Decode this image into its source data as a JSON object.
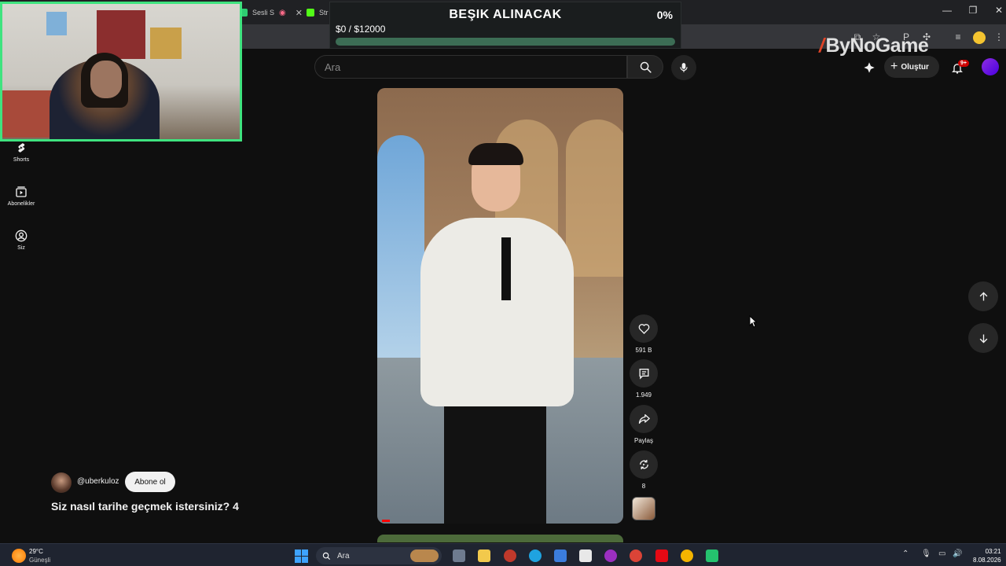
{
  "browser": {
    "tabs": [
      {
        "label": "Sesli S"
      },
      {
        "label": "Str"
      }
    ],
    "window_controls": [
      "—",
      "❐",
      "✕"
    ]
  },
  "goal": {
    "title": "BEŞIK ALINACAK",
    "percent_label": "0%",
    "amount": "$0 / $12000",
    "progress_fraction": 0.0
  },
  "watermark": {
    "logo_text": "ByNoGame"
  },
  "header": {
    "search_placeholder": "Ara",
    "create_label": "Oluştur",
    "notifications_badge": "9+"
  },
  "sidebar": {
    "items": [
      {
        "label": "Shorts",
        "icon": "shorts-icon"
      },
      {
        "label": "Abonelikler",
        "icon": "subscriptions-icon"
      },
      {
        "label": "Siz",
        "icon": "you-icon"
      }
    ]
  },
  "short": {
    "channel": "@uberkuloz",
    "subscribe_label": "Abone ol",
    "title": "Siz nasıl tarihe geçmek istersiniz? 4",
    "actions": {
      "like_count": "591 B",
      "comment_count": "1.949",
      "share_label": "Paylaş",
      "remix_count": "8"
    }
  },
  "taskbar": {
    "temperature": "29°C",
    "weather": "Güneşli",
    "search_label": "Ara",
    "time": "03:21",
    "date": "8.08.2026"
  },
  "colors": {
    "background": "#0f0f0f",
    "goal_bar": "#5cdb95",
    "webcam_border": "#3fe37f",
    "notification_red": "#cc0000"
  }
}
